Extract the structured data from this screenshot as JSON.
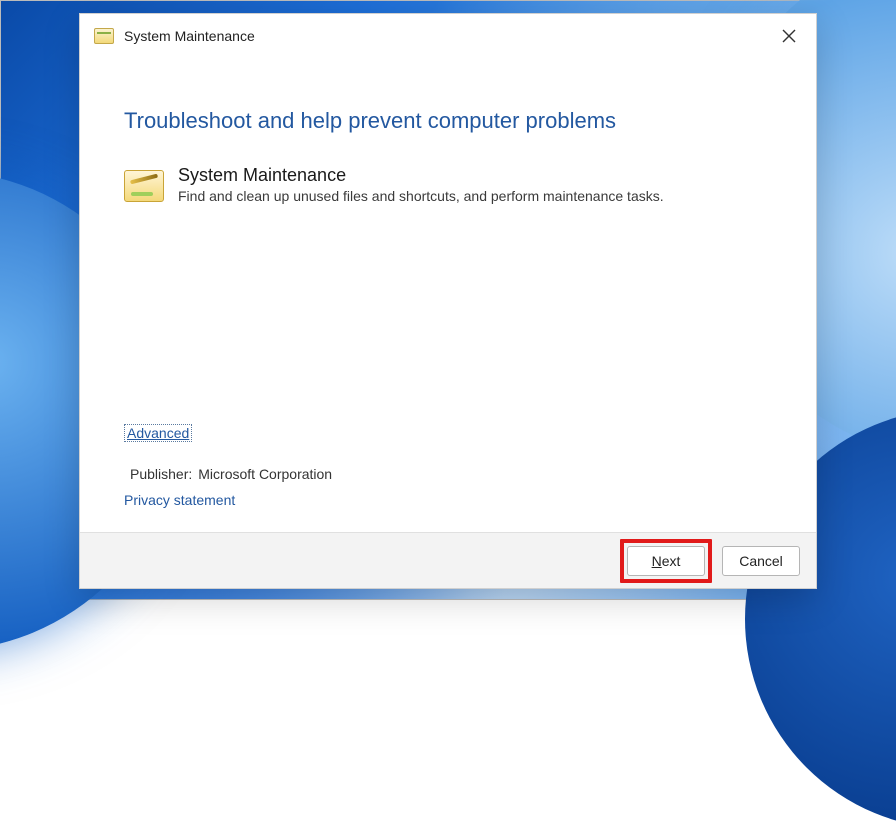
{
  "titlebar": {
    "title": "System Maintenance"
  },
  "content": {
    "heading": "Troubleshoot and help prevent computer problems",
    "item": {
      "title": "System Maintenance",
      "description": "Find and clean up unused files and shortcuts, and perform maintenance tasks."
    },
    "advanced_link": "Advanced",
    "publisher_label": "Publisher:",
    "publisher_value": "Microsoft Corporation",
    "privacy_link": "Privacy statement"
  },
  "buttons": {
    "next_prefix": "N",
    "next_suffix": "ext",
    "cancel": "Cancel"
  }
}
